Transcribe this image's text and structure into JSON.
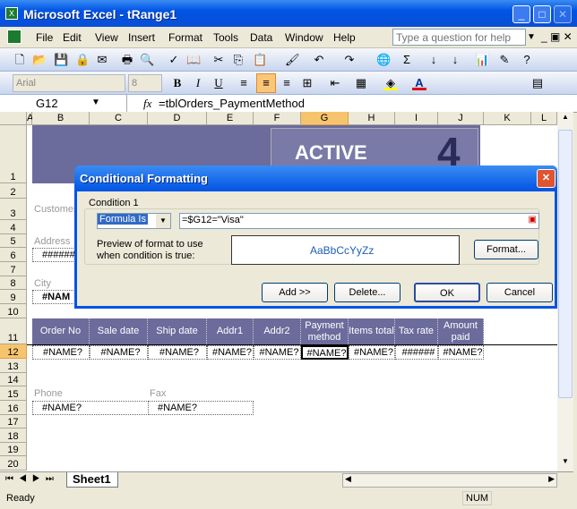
{
  "window": {
    "title": "Microsoft Excel - tRange1",
    "minimize": "_",
    "maximize": "□",
    "close": "✕"
  },
  "menu": [
    "File",
    "Edit",
    "View",
    "Insert",
    "Format",
    "Tools",
    "Data",
    "Window",
    "Help"
  ],
  "help_placeholder": "Type a question for help",
  "toolbar": {
    "font": "Arial",
    "size": "8",
    "bold": "B",
    "italic": "I",
    "underline": "U"
  },
  "formula_bar": {
    "name_box": "G12",
    "fx": "fx",
    "formula": "=tblOrders_PaymentMethod"
  },
  "columns": [
    "A",
    "B",
    "C",
    "D",
    "E",
    "F",
    "G",
    "H",
    "I",
    "J",
    "K",
    "L"
  ],
  "rows": [
    "1",
    "2",
    "3",
    "4",
    "5",
    "6",
    "7",
    "8",
    "9",
    "10",
    "11",
    "12",
    "13",
    "14",
    "15",
    "16",
    "17",
    "18",
    "19",
    "20"
  ],
  "selected_cell": {
    "column": "G",
    "row": "12"
  },
  "sheet": {
    "labels": {
      "customer": "Customer",
      "address": "Address",
      "address_value": "######",
      "city": "City",
      "city_value": "#NAM",
      "phone": "Phone",
      "fax": "Fax",
      "phone_value": "#NAME?",
      "fax_value": "#NAME?"
    },
    "table_headers": [
      "Order No",
      "Sale date",
      "Ship date",
      "Addr1",
      "Addr2",
      "Payment method",
      "Items total",
      "Tax rate",
      "Amount paid"
    ],
    "table_row": [
      "#NAME?",
      "#NAME?",
      "#NAME?",
      "#NAME?",
      "#NAME?",
      "#NAME?",
      "#NAME?",
      "######",
      "#NAME?"
    ],
    "banner_text": "ACTIVE"
  },
  "dialog": {
    "title": "Conditional Formatting",
    "condition_label": "Condition 1",
    "condition_type": "Formula Is",
    "formula": "=$G12=\"Visa\"",
    "preview_label": "Preview of format to use when condition is true:",
    "preview_text": "AaBbCcYyZz",
    "format_button": "Format...",
    "add_button": "Add >>",
    "delete_button": "Delete...",
    "ok_button": "OK",
    "cancel_button": "Cancel"
  },
  "sheet_tabs": [
    "Sheet1"
  ],
  "status": {
    "text": "Ready",
    "num": "NUM"
  }
}
